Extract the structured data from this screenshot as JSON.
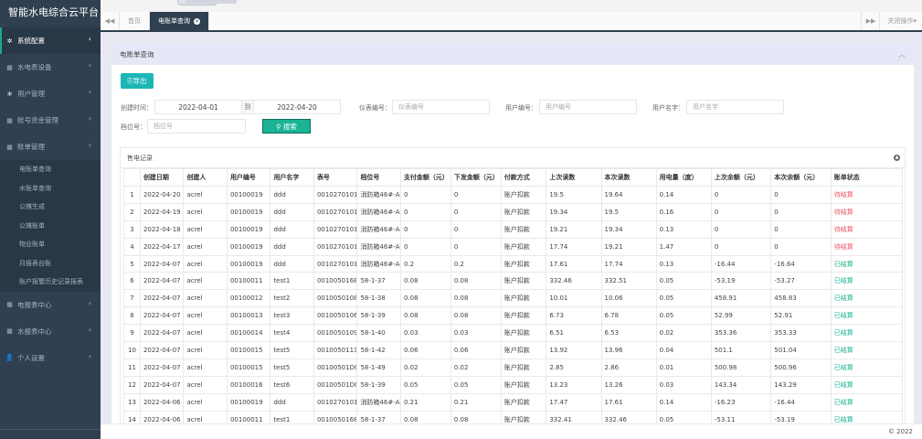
{
  "app": {
    "title": "智能水电综合云平台"
  },
  "sidebar": {
    "items": [
      {
        "label": "系统配置",
        "icon": "gear-icon"
      },
      {
        "label": "水电表设备",
        "icon": "calendar-icon"
      },
      {
        "label": "用户管理",
        "icon": "asterisk-icon"
      },
      {
        "label": "账号资金管理",
        "icon": "calendar-icon"
      },
      {
        "label": "账单管理",
        "icon": "calendar-icon"
      }
    ],
    "subitems": [
      "电账单查询",
      "水账单查询",
      "公摊生成",
      "公摊账单",
      "物业账单",
      "月报表台账",
      "账户报警历史记录报表"
    ],
    "items_bottom": [
      {
        "label": "电报表中心",
        "icon": "calendar-icon"
      },
      {
        "label": "水报表中心",
        "icon": "calendar-icon"
      },
      {
        "label": "个人设置",
        "icon": "user-icon"
      }
    ]
  },
  "tabs": {
    "home": "首页",
    "active": "电账单查询",
    "close_ops": "关闭操作"
  },
  "panel": {
    "title": "电账单查询"
  },
  "toolbar": {
    "export_label": "导出"
  },
  "filters": {
    "create_time_label": "创建时间：",
    "date_from": "2022-04-01",
    "to_label": "到",
    "date_to": "2022-04-20",
    "meter_no_label": "仪表编号：",
    "meter_no_placeholder": "仪表编号",
    "user_no_label": "用户编号：",
    "user_no_placeholder": "用户编号",
    "user_name_label": "用户名字：",
    "user_name_placeholder": "用户名字",
    "stall_label": "档位号：",
    "stall_placeholder": "档位号",
    "search_label": "搜索"
  },
  "records": {
    "title": "售电记录",
    "columns": [
      "",
      "创建日期",
      "创建人",
      "用户编号",
      "用户名字",
      "表号",
      "档位号",
      "支付金额（元）",
      "下发金额（元）",
      "付款方式",
      "上次读数",
      "本次读数",
      "用电量（度）",
      "上次余额（元）",
      "本次余额（元）",
      "账单状态"
    ],
    "rows": [
      [
        "1",
        "2022-04-20",
        "acrel",
        "00100019",
        "ddd",
        "0010270101",
        "消防箱46#-A",
        "0",
        "0",
        "账户扣款",
        "19.5",
        "19.64",
        "0.14",
        "0",
        "0",
        "待结算"
      ],
      [
        "2",
        "2022-04-19",
        "acrel",
        "00100019",
        "ddd",
        "0010270101",
        "消防箱46#-A",
        "0",
        "0",
        "账户扣款",
        "19.34",
        "19.5",
        "0.16",
        "0",
        "0",
        "待结算"
      ],
      [
        "3",
        "2022-04-18",
        "acrel",
        "00100019",
        "ddd",
        "0010270101",
        "消防箱46#-A",
        "0",
        "0",
        "账户扣款",
        "19.21",
        "19.34",
        "0.13",
        "0",
        "0",
        "待结算"
      ],
      [
        "4",
        "2022-04-17",
        "acrel",
        "00100019",
        "ddd",
        "0010270101",
        "消防箱46#-A",
        "0",
        "0",
        "账户扣款",
        "17.74",
        "19.21",
        "1.47",
        "0",
        "0",
        "待结算"
      ],
      [
        "5",
        "2022-04-07",
        "acrel",
        "00100019",
        "ddd",
        "0010270101",
        "消防箱46#-A",
        "0.2",
        "0.2",
        "账户扣款",
        "17.61",
        "17.74",
        "0.13",
        "-16.44",
        "-16.64",
        "已结算"
      ],
      [
        "6",
        "2022-04-07",
        "acrel",
        "00100011",
        "test1",
        "0010050168",
        "58-1-37",
        "0.08",
        "0.08",
        "账户扣款",
        "332.46",
        "332.51",
        "0.05",
        "-53.19",
        "-53.27",
        "已结算"
      ],
      [
        "7",
        "2022-04-07",
        "acrel",
        "00100012",
        "test2",
        "0010050108",
        "58-1-38",
        "0.08",
        "0.08",
        "账户扣款",
        "10.01",
        "10.06",
        "0.05",
        "458.91",
        "458.83",
        "已结算"
      ],
      [
        "8",
        "2022-04-07",
        "acrel",
        "00100013",
        "test3",
        "0010050106",
        "58-1-39",
        "0.08",
        "0.08",
        "账户扣款",
        "6.73",
        "6.78",
        "0.05",
        "52.99",
        "52.91",
        "已结算"
      ],
      [
        "9",
        "2022-04-07",
        "acrel",
        "00100014",
        "test4",
        "0010050109",
        "58-1-40",
        "0.03",
        "0.03",
        "账户扣款",
        "6.51",
        "6.53",
        "0.02",
        "353.36",
        "353.33",
        "已结算"
      ],
      [
        "10",
        "2022-04-07",
        "acrel",
        "00100015",
        "test5",
        "0010050113",
        "58-1-42",
        "0.06",
        "0.06",
        "账户扣款",
        "13.92",
        "13.96",
        "0.04",
        "501.1",
        "501.04",
        "已结算"
      ],
      [
        "11",
        "2022-04-07",
        "acrel",
        "00100015",
        "test5",
        "00100501DC",
        "58-1-49",
        "0.02",
        "0.02",
        "账户扣款",
        "2.85",
        "2.86",
        "0.01",
        "500.98",
        "500.96",
        "已结算"
      ],
      [
        "12",
        "2022-04-07",
        "acrel",
        "00100016",
        "test6",
        "00100501DC",
        "58-1-39",
        "0.05",
        "0.05",
        "账户扣款",
        "13.23",
        "13.26",
        "0.03",
        "143.34",
        "143.29",
        "已结算"
      ],
      [
        "13",
        "2022-04-06",
        "acrel",
        "00100019",
        "ddd",
        "0010270101",
        "消防箱46#-A",
        "0.21",
        "0.21",
        "账户扣款",
        "17.47",
        "17.61",
        "0.14",
        "-16.23",
        "-16.44",
        "已结算"
      ],
      [
        "14",
        "2022-04-06",
        "acrel",
        "00100011",
        "test1",
        "0010050168",
        "58-1-37",
        "0.08",
        "0.08",
        "账户扣款",
        "332.41",
        "332.46",
        "0.05",
        "-53.11",
        "-53.19",
        "已结算"
      ]
    ]
  },
  "colors": {
    "sidebar_bg": "#2f4050",
    "accent": "#1ab394",
    "export_btn": "#1ab7b5",
    "pending": "#ed5565",
    "done": "#1ab394"
  },
  "footer": {
    "copyright": "© 2022"
  }
}
